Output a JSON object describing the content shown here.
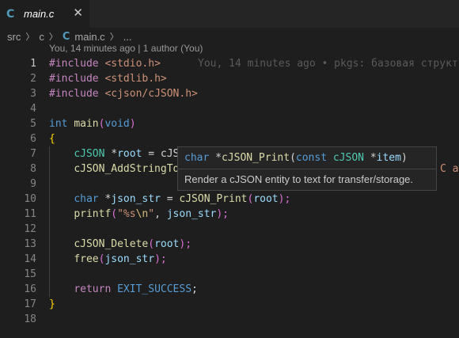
{
  "tab": {
    "name": "main.c",
    "icon": "c-file-icon",
    "close": "✕"
  },
  "breadcrumb": {
    "items": [
      "src",
      "c",
      "main.c",
      "..."
    ]
  },
  "codelens": "You, 14 minutes ago | 1 author (You)",
  "blame": "You, 14 minutes ago • pkgs: базовая структу",
  "active_line": 1,
  "line_numbers": [
    "1",
    "2",
    "3",
    "4",
    "5",
    "6",
    "7",
    "8",
    "9",
    "10",
    "11",
    "12",
    "13",
    "14",
    "15",
    "16",
    "17",
    "18"
  ],
  "code": {
    "l1": [
      "#include",
      " ",
      "<stdio.h>"
    ],
    "l2": [
      "#include",
      " ",
      "<stdlib.h>"
    ],
    "l3": [
      "#include",
      " ",
      "<cjson/cJSON.h>"
    ],
    "l5": [
      "int",
      " ",
      "main",
      "(",
      "void",
      ")"
    ],
    "l6": [
      "{"
    ],
    "l7": [
      "    ",
      "cJSON",
      " *",
      "root",
      " = cJS"
    ],
    "l8": [
      "    ",
      "cJSON_AddStringTo"
    ],
    "l10": [
      "    ",
      "char",
      " *",
      "json_str",
      " = ",
      "cJSON_Print",
      "(",
      "root",
      ");"
    ],
    "l11": [
      "    ",
      "printf",
      "(",
      "\"%s",
      "\\n",
      "\"",
      ", ",
      "json_str",
      ");"
    ],
    "l13": [
      "    ",
      "cJSON_Delete",
      "(",
      "root",
      ");"
    ],
    "l14": [
      "    ",
      "free",
      "(",
      "json_str",
      ");"
    ],
    "l16": [
      "    ",
      "return",
      " ",
      "EXIT_SUCCESS",
      ";"
    ],
    "l17": [
      "}"
    ]
  },
  "behind_text": "C ar",
  "hover": {
    "sig": [
      "char",
      " *",
      "cJSON_Print",
      "(",
      "const",
      " ",
      "cJSON",
      " *",
      "item",
      ")"
    ],
    "doc": "Render a cJSON entity to text for transfer/storage."
  },
  "colors": {
    "background": "#1e1e1e",
    "keyword": "#569cd6",
    "directive": "#c586c0",
    "string": "#ce9178",
    "function": "#dcdcaa",
    "type": "#4ec9b0",
    "variable": "#9cdcfe",
    "brace": "#ffd700",
    "paren": "#da70d6"
  }
}
